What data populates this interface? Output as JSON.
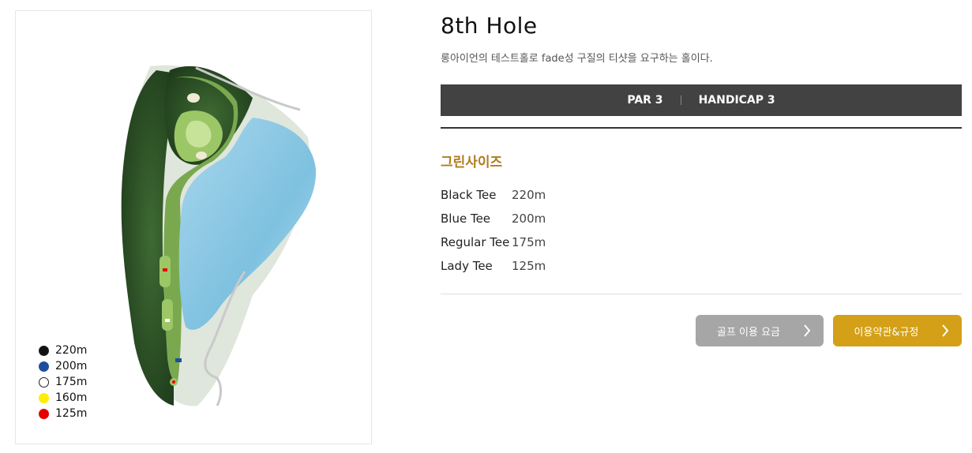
{
  "hole": {
    "title": "8th Hole",
    "description": "롱아이언의 테스트홀로 fade성 구질의 티샷을 요구하는 홀이다."
  },
  "par_bar": {
    "par": "PAR 3",
    "handicap": "HANDICAP 3"
  },
  "green_size": {
    "title": "그린사이즈",
    "tees": [
      {
        "name": "Black Tee",
        "distance": "220m"
      },
      {
        "name": "Blue Tee",
        "distance": "200m"
      },
      {
        "name": "Regular Tee",
        "distance": "175m"
      },
      {
        "name": "Lady Tee",
        "distance": "125m"
      }
    ]
  },
  "legend": {
    "items": [
      {
        "label": "220m",
        "color": "#111111"
      },
      {
        "label": "200m",
        "color": "#1f4e9c"
      },
      {
        "label": "175m",
        "color": "#ffffff"
      },
      {
        "label": "160m",
        "color": "#ffee00"
      },
      {
        "label": "125m",
        "color": "#e60000"
      }
    ]
  },
  "buttons": {
    "fee": "골프 이용 요금",
    "terms": "이용약관&규정",
    "fee_color": "#a6a6a6",
    "terms_color": "#d4a017",
    "arrow_icon": "chevron-right-icon"
  }
}
